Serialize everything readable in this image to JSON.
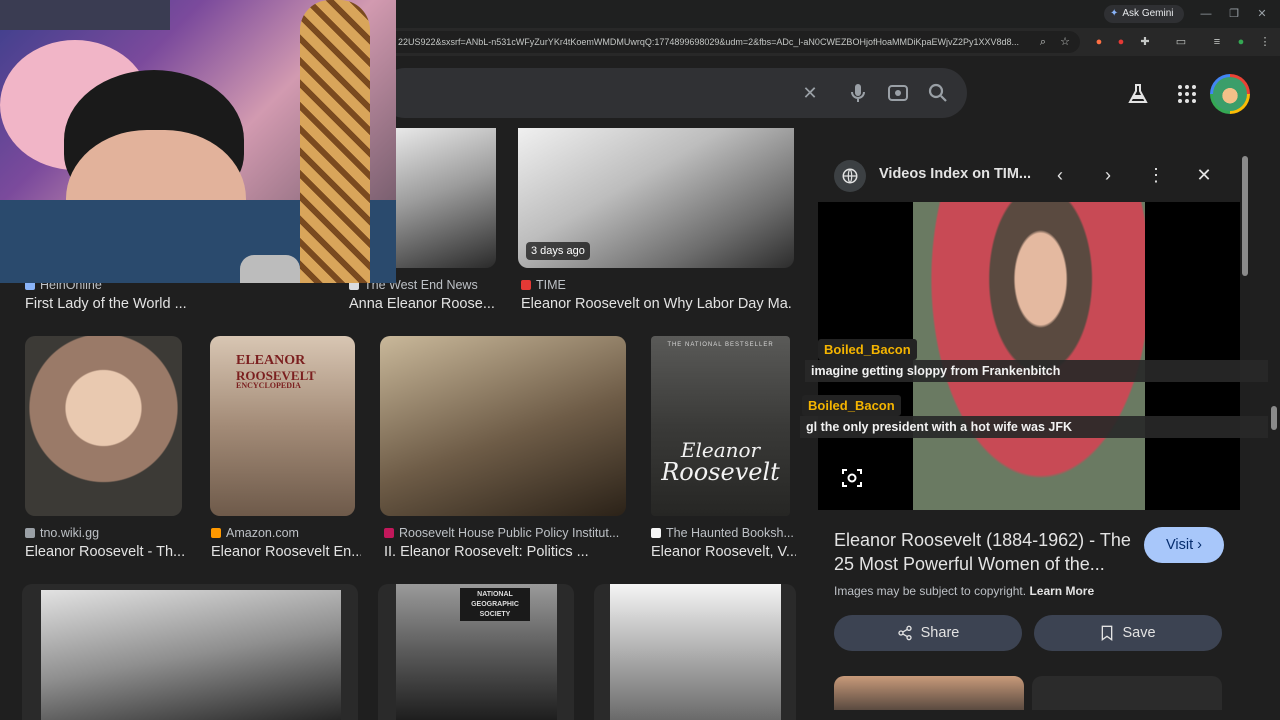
{
  "browser": {
    "ask_gemini": "Ask Gemini",
    "url": "22US922&sxsrf=ANbL-n531cWFyZurYKr4tKoemWMDMUwrqQ:1774899698029&udm=2&fbs=ADc_l-aN0CWEZBOHjofHoaMMDiKpaEWjvZ2Py1XXV8d8..."
  },
  "results": {
    "row1": [
      {
        "source": "HeinOnline",
        "title": "First Lady of the World ...",
        "favicon_color": "#8ab4f8"
      },
      {
        "source": "The West End News",
        "title": "Anna Eleanor Roose...",
        "favicon_color": "#dadce0"
      },
      {
        "source": "TIME",
        "title": "Eleanor Roosevelt on Why Labor Day Ma...",
        "favicon_color": "#e53935",
        "badge": "3 days ago"
      }
    ],
    "row2": [
      {
        "source": "tno.wiki.gg",
        "title": "Eleanor Roosevelt - Th...",
        "favicon_color": "#9aa0a6"
      },
      {
        "source": "Amazon.com",
        "title": "Eleanor Roosevelt En...",
        "favicon_color": "#ff9900"
      },
      {
        "source": "Roosevelt House Public Policy Institut...",
        "title": "II. Eleanor Roosevelt: Politics ...",
        "favicon_color": "#c2185b"
      },
      {
        "source": "The Haunted Booksh...",
        "title": "Eleanor Roosevelt, V...",
        "favicon_color": "#f5f5f5"
      }
    ],
    "book_cover": {
      "top_text": "THE NATIONAL BESTSELLER",
      "script_line1": "Eleanor",
      "script_line2": "Roosevelt"
    },
    "encyclopedia_cover": {
      "line1": "ELEANOR",
      "line2": "ROOSEVELT",
      "line3": "ENCYCLOPEDIA"
    },
    "national_geographic_sign": "NATIONAL GEOGRAPHIC SOCIETY"
  },
  "panel": {
    "source_title": "Videos Index on TIM...",
    "title": "Eleanor Roosevelt (1884-1962) - The 25 Most Powerful Women of the...",
    "copyright": "Images may be subject to copyright.",
    "learn_more": "Learn More",
    "visit": "Visit",
    "share": "Share",
    "save": "Save"
  },
  "chat": [
    {
      "user": "Boiled_Bacon",
      "message": "imagine getting sloppy from Frankenbitch"
    },
    {
      "user": "Boiled_Bacon",
      "message": "gl the only president with a hot wife was JFK"
    }
  ],
  "colors": {
    "accent": "#a8c7fa",
    "chat_name": "#f4b400"
  }
}
